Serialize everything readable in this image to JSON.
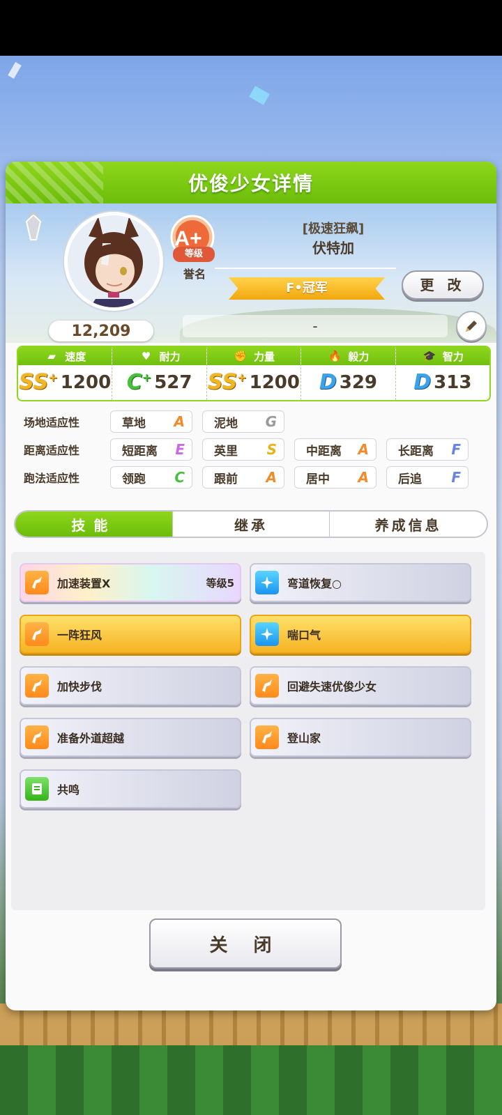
{
  "dialog": {
    "title": "优俊少女详情"
  },
  "profile": {
    "score": "12,209",
    "rank": "A+",
    "rank_sub": "等级",
    "fame_label": "誉名",
    "epithet": "[极速狂飙]",
    "name": "伏特加",
    "title_banner": "F•冠军",
    "change_label": "更 改",
    "memo": "-"
  },
  "stats": [
    {
      "label": "速度",
      "icon": "shoe-icon",
      "grade": "SS",
      "plus": "+",
      "value": "1200"
    },
    {
      "label": "耐力",
      "icon": "heart-icon",
      "grade": "C",
      "plus": "+",
      "value": "527"
    },
    {
      "label": "力量",
      "icon": "muscle-icon",
      "grade": "SS",
      "plus": "+",
      "value": "1200"
    },
    {
      "label": "毅力",
      "icon": "flame-icon",
      "grade": "D",
      "plus": "",
      "value": "329"
    },
    {
      "label": "智力",
      "icon": "graduation-cap-icon",
      "grade": "D",
      "plus": "",
      "value": "313"
    }
  ],
  "aptitudes": {
    "track": {
      "label": "场地适应性",
      "items": [
        {
          "name": "草地",
          "grade": "A"
        },
        {
          "name": "泥地",
          "grade": "G"
        }
      ]
    },
    "distance": {
      "label": "距离适应性",
      "items": [
        {
          "name": "短距离",
          "grade": "E"
        },
        {
          "name": "英里",
          "grade": "S"
        },
        {
          "name": "中距离",
          "grade": "A"
        },
        {
          "name": "长距离",
          "grade": "F"
        }
      ]
    },
    "style": {
      "label": "跑法适应性",
      "items": [
        {
          "name": "领跑",
          "grade": "C"
        },
        {
          "name": "跟前",
          "grade": "A"
        },
        {
          "name": "居中",
          "grade": "A"
        },
        {
          "name": "后追",
          "grade": "F"
        }
      ]
    }
  },
  "tabs": [
    {
      "label": "技能"
    },
    {
      "label": "继承"
    },
    {
      "label": "养成信息"
    }
  ],
  "skills": [
    {
      "name": "加速装置X",
      "level": "等级5",
      "icon": "speed-skill-icon"
    },
    {
      "name": "弯道恢复○",
      "level": "",
      "icon": "recovery-skill-icon"
    },
    {
      "name": "一阵狂风",
      "level": "",
      "icon": "speed-skill-icon"
    },
    {
      "name": "喘口气",
      "level": "",
      "icon": "recovery-skill-icon"
    },
    {
      "name": "加快步伐",
      "level": "",
      "icon": "speed-skill-icon"
    },
    {
      "name": "回避失速优俊少女",
      "level": "",
      "icon": "speed-skill-icon"
    },
    {
      "name": "准备外道超越",
      "level": "",
      "icon": "speed-skill-icon"
    },
    {
      "name": "登山家",
      "level": "",
      "icon": "speed-skill-icon"
    },
    {
      "name": "共鸣",
      "level": "",
      "icon": "passive-skill-icon"
    }
  ],
  "close_label": "关 闭"
}
